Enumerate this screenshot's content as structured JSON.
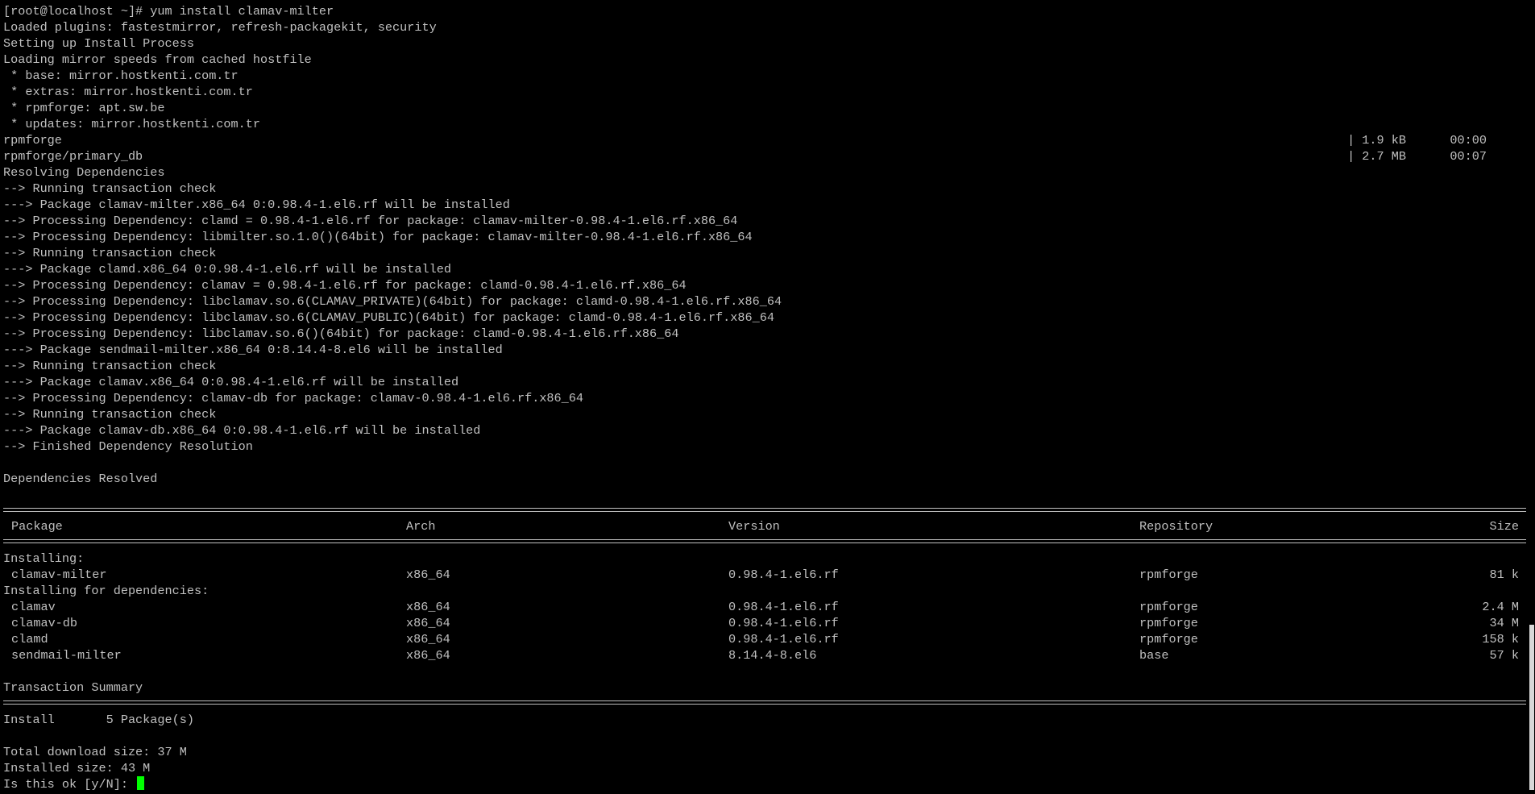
{
  "terminal": {
    "lines": [
      "[root@localhost ~]# yum install clamav-milter",
      "Loaded plugins: fastestmirror, refresh-packagekit, security",
      "Setting up Install Process",
      "Loading mirror speeds from cached hostfile",
      " * base: mirror.hostkenti.com.tr",
      " * extras: mirror.hostkenti.com.tr",
      " * rpmforge: apt.sw.be",
      " * updates: mirror.hostkenti.com.tr",
      "rpmforge",
      "rpmforge/primary_db",
      "Resolving Dependencies",
      "--> Running transaction check",
      "---> Package clamav-milter.x86_64 0:0.98.4-1.el6.rf will be installed",
      "--> Processing Dependency: clamd = 0.98.4-1.el6.rf for package: clamav-milter-0.98.4-1.el6.rf.x86_64",
      "--> Processing Dependency: libmilter.so.1.0()(64bit) for package: clamav-milter-0.98.4-1.el6.rf.x86_64",
      "--> Running transaction check",
      "---> Package clamd.x86_64 0:0.98.4-1.el6.rf will be installed",
      "--> Processing Dependency: clamav = 0.98.4-1.el6.rf for package: clamd-0.98.4-1.el6.rf.x86_64",
      "--> Processing Dependency: libclamav.so.6(CLAMAV_PRIVATE)(64bit) for package: clamd-0.98.4-1.el6.rf.x86_64",
      "--> Processing Dependency: libclamav.so.6(CLAMAV_PUBLIC)(64bit) for package: clamd-0.98.4-1.el6.rf.x86_64",
      "--> Processing Dependency: libclamav.so.6()(64bit) for package: clamd-0.98.4-1.el6.rf.x86_64",
      "---> Package sendmail-milter.x86_64 0:8.14.4-8.el6 will be installed",
      "--> Running transaction check",
      "---> Package clamav.x86_64 0:0.98.4-1.el6.rf will be installed",
      "--> Processing Dependency: clamav-db for package: clamav-0.98.4-1.el6.rf.x86_64",
      "--> Running transaction check",
      "---> Package clamav-db.x86_64 0:0.98.4-1.el6.rf will be installed",
      "--> Finished Dependency Resolution",
      "",
      "Dependencies Resolved"
    ],
    "download_progress": [
      {
        "size": "| 1.9 kB",
        "time": "00:00"
      },
      {
        "size": "| 2.7 MB",
        "time": "00:07"
      }
    ],
    "table": {
      "headers": {
        "package": "Package",
        "arch": "Arch",
        "version": "Version",
        "repository": "Repository",
        "size": "Size"
      },
      "installing_label": "Installing:",
      "installing": [
        {
          "package": "clamav-milter",
          "arch": "x86_64",
          "version": "0.98.4-1.el6.rf",
          "repository": "rpmforge",
          "size": "81 k"
        }
      ],
      "deps_label": "Installing for dependencies:",
      "dependencies": [
        {
          "package": "clamav",
          "arch": "x86_64",
          "version": "0.98.4-1.el6.rf",
          "repository": "rpmforge",
          "size": "2.4 M"
        },
        {
          "package": "clamav-db",
          "arch": "x86_64",
          "version": "0.98.4-1.el6.rf",
          "repository": "rpmforge",
          "size": "34 M"
        },
        {
          "package": "clamd",
          "arch": "x86_64",
          "version": "0.98.4-1.el6.rf",
          "repository": "rpmforge",
          "size": "158 k"
        },
        {
          "package": "sendmail-milter",
          "arch": "x86_64",
          "version": "8.14.4-8.el6",
          "repository": "base",
          "size": "57 k"
        }
      ]
    },
    "summary": {
      "title": "Transaction Summary",
      "install_line": "Install       5 Package(s)",
      "download_size": "Total download size: 37 M",
      "installed_size": "Installed size: 43 M",
      "prompt": "Is this ok [y/N]: "
    },
    "colors": {
      "background": "#000000",
      "foreground": "#c0c0c0",
      "cursor": "#00ff00"
    }
  }
}
